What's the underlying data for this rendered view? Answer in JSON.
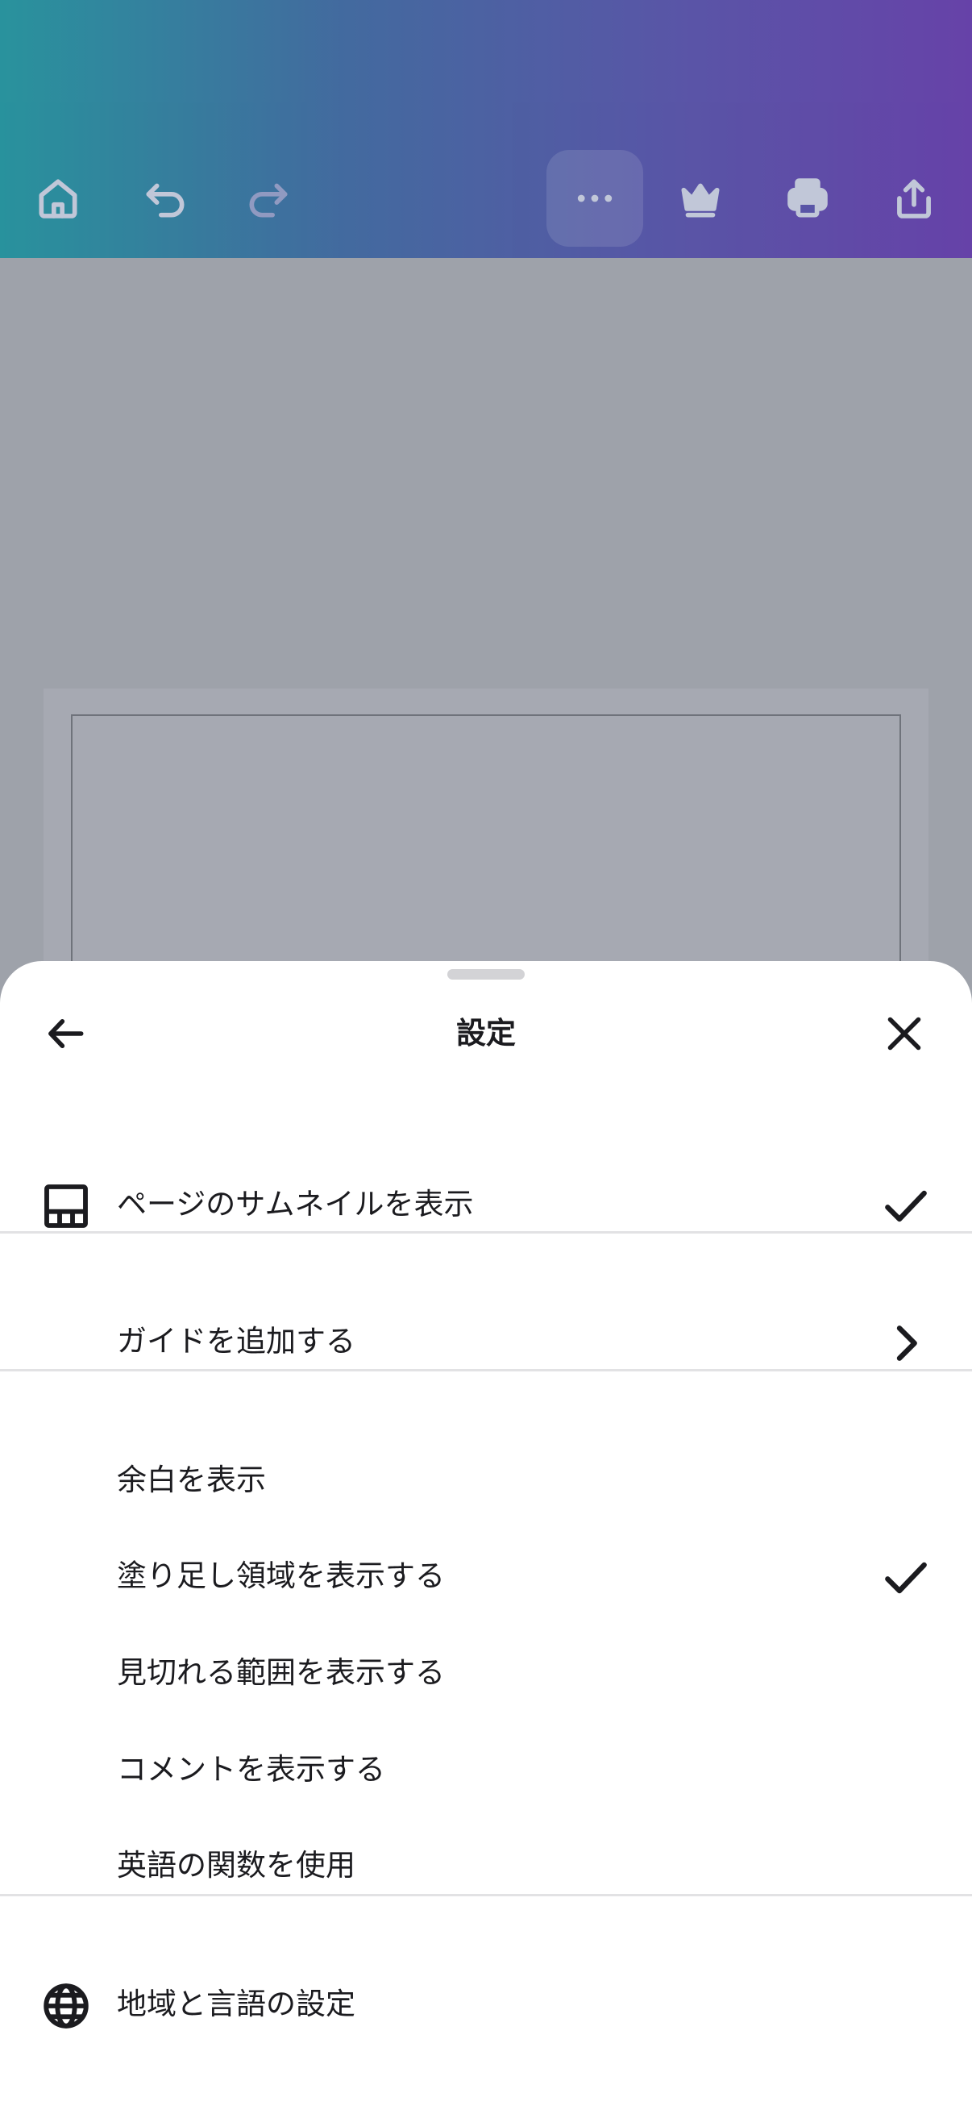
{
  "toolbar": {
    "icons": [
      "home-icon",
      "undo-icon",
      "redo-icon",
      "more-icon",
      "crown-icon",
      "print-icon",
      "share-icon"
    ]
  },
  "sheet": {
    "title": "設定",
    "back_icon": "arrow-left-icon",
    "close_icon": "close-icon",
    "sections": [
      [
        {
          "label": "ページのサムネイルを表示",
          "icon": "thumbnails-icon",
          "checked": true
        }
      ],
      [
        {
          "label": "ガイドを追加する",
          "trailing": "chevron-right-icon"
        }
      ],
      [
        {
          "label": "余白を表示",
          "checked": false
        },
        {
          "label": "塗り足し領域を表示する",
          "checked": true
        },
        {
          "label": "見切れる範囲を表示する",
          "checked": false
        },
        {
          "label": "コメントを表示する",
          "checked": false
        },
        {
          "label": "英語の関数を使用",
          "checked": false
        }
      ],
      [
        {
          "label": "地域と言語の設定",
          "icon": "globe-icon"
        }
      ]
    ]
  },
  "colors": {
    "toolbar_gradient_start": "#0f8f9a",
    "toolbar_gradient_end": "#5a2da8",
    "sheet_background": "#ffffff",
    "text": "#1b1b1f"
  }
}
